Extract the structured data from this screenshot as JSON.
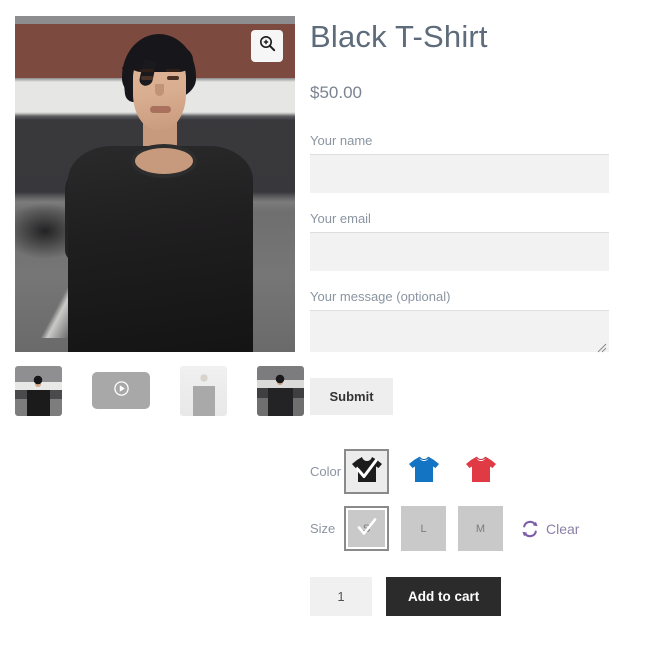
{
  "gallery": {
    "zoom_icon": "magnifier-plus-icon",
    "main_image_alt": "Man wearing black t-shirt on city street",
    "thumbnails": [
      {
        "name": "thumbnail-photo-1",
        "type": "image",
        "alt": "Man in black t-shirt"
      },
      {
        "name": "thumbnail-video",
        "type": "video",
        "icon": "play-circle-icon",
        "alt": "Product video"
      },
      {
        "name": "thumbnail-photo-3",
        "type": "image",
        "alt": "Woman in gray t-shirt"
      },
      {
        "name": "thumbnail-photo-4",
        "type": "image",
        "alt": "Man in black t-shirt outdoors"
      }
    ]
  },
  "product": {
    "title": "Black T-Shirt",
    "price": "$50.00"
  },
  "form": {
    "fields": [
      {
        "label": "Your name",
        "value": "",
        "placeholder": "",
        "name": "your-name-field"
      },
      {
        "label": "Your email",
        "value": "",
        "placeholder": "",
        "name": "your-email-field"
      },
      {
        "label": "Your message (optional)",
        "value": "",
        "placeholder": "",
        "name": "your-message-field"
      }
    ],
    "submit_label": "Submit"
  },
  "variations": {
    "color": {
      "label": "Color",
      "options": [
        {
          "name": "color-swatch-black",
          "color": "#1c1c1c",
          "selected": true
        },
        {
          "name": "color-swatch-blue",
          "color": "#1474c4",
          "selected": false
        },
        {
          "name": "color-swatch-red",
          "color": "#e03a45",
          "selected": false
        }
      ]
    },
    "size": {
      "label": "Size",
      "options": [
        {
          "name": "size-swatch-s",
          "label": "S",
          "selected": true
        },
        {
          "name": "size-swatch-l",
          "label": "L",
          "selected": false
        },
        {
          "name": "size-swatch-m",
          "label": "M",
          "selected": false
        }
      ]
    },
    "clear_label": "Clear",
    "clear_icon": "refresh-icon",
    "clear_color": "#7b5ea7"
  },
  "cart": {
    "quantity": "1",
    "add_to_cart_label": "Add to cart"
  },
  "colors": {
    "title": "#5e6b7a",
    "label": "#8b95a1",
    "input_bg": "#f2f2f2",
    "button_dark": "#2b2b2b",
    "swatch_gray": "#c9c9c9"
  }
}
